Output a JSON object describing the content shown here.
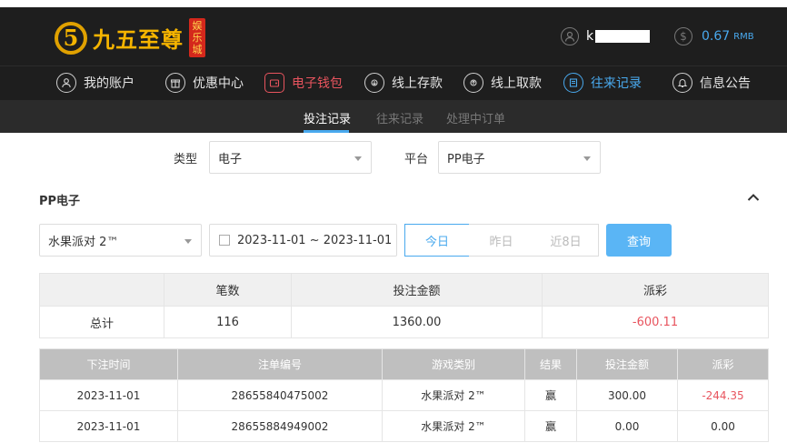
{
  "header": {
    "logo_badge": "5",
    "logo_text": "九五至尊",
    "logo_sub": "娱乐城",
    "username": "k",
    "balance": "0.67",
    "currency": "RMB"
  },
  "nav": {
    "items": [
      {
        "label": "我的账户",
        "icon": "user-icon"
      },
      {
        "label": "优惠中心",
        "icon": "gift-icon"
      },
      {
        "label": "电子钱包",
        "icon": "wallet-icon"
      },
      {
        "label": "线上存款",
        "icon": "deposit-icon"
      },
      {
        "label": "线上取款",
        "icon": "withdraw-icon"
      },
      {
        "label": "往来记录",
        "icon": "records-icon"
      },
      {
        "label": "信息公告",
        "icon": "bell-icon"
      }
    ]
  },
  "subnav": {
    "items": [
      "投注记录",
      "往来记录",
      "处理中订单"
    ]
  },
  "filters": {
    "type_label": "类型",
    "type_value": "电子",
    "platform_label": "平台",
    "platform_value": "PP电子"
  },
  "section": {
    "title": "PP电子",
    "game_value": "水果派对 2™",
    "date_range": "2023-11-01 ~ 2023-11-01",
    "seg_today": "今日",
    "seg_yesterday": "昨日",
    "seg_8days": "近8日",
    "query_label": "查询"
  },
  "summary": {
    "headers": [
      "",
      "笔数",
      "投注金额",
      "派彩"
    ],
    "row": [
      "总计",
      "116",
      "1360.00",
      "-600.11"
    ]
  },
  "details": {
    "headers": [
      "下注时间",
      "注单编号",
      "游戏类别",
      "结果",
      "投注金额",
      "派彩"
    ],
    "rows": [
      [
        "2023-11-01",
        "28655840475002",
        "水果派对 2™",
        "赢",
        "300.00",
        "-244.35"
      ],
      [
        "2023-11-01",
        "28655884949002",
        "水果派对 2™",
        "赢",
        "0.00",
        "0.00"
      ]
    ]
  },
  "colors": {
    "accent": "#49a9ee",
    "negative": "#e8545e",
    "topbar": "#1e1e1e"
  }
}
